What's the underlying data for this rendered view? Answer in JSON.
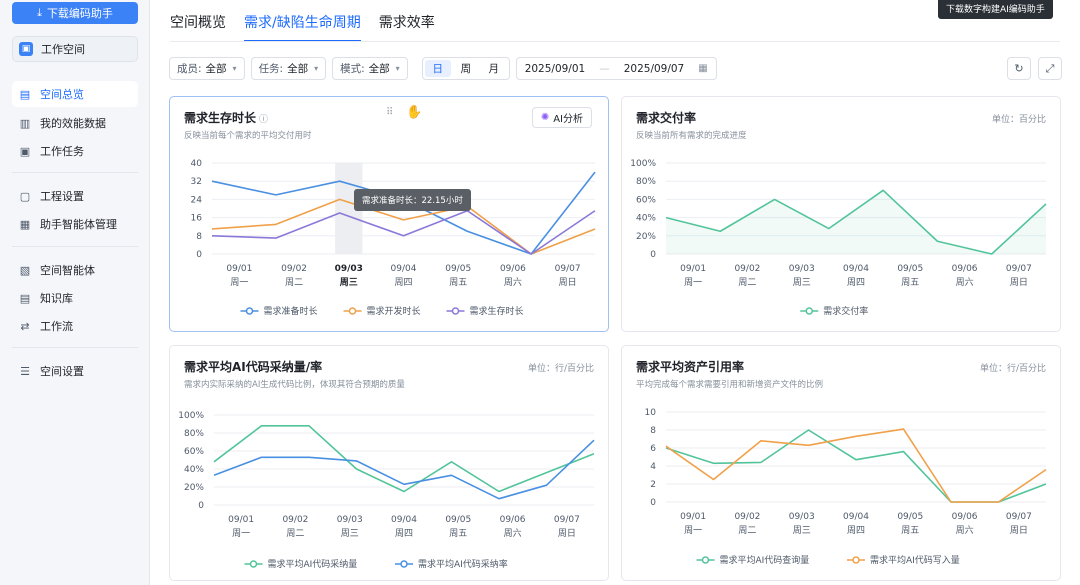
{
  "sidebar": {
    "download_label": "下载编码助手",
    "workspace_label": "工作空间",
    "items": [
      {
        "label": "空间总览",
        "icon": "overview-icon",
        "active": true
      },
      {
        "label": "我的效能数据",
        "icon": "chart-icon"
      },
      {
        "label": "工作任务",
        "icon": "task-icon"
      },
      {
        "label": "工程设置",
        "icon": "project-icon"
      },
      {
        "label": "助手智能体管理",
        "icon": "agent-icon"
      },
      {
        "label": "空间智能体",
        "icon": "space-agent-icon"
      },
      {
        "label": "知识库",
        "icon": "knowledge-icon"
      },
      {
        "label": "工作流",
        "icon": "workflow-icon"
      },
      {
        "label": "空间设置",
        "icon": "settings-icon"
      }
    ]
  },
  "header": {
    "tabs": [
      "空间概览",
      "需求/缺陷生命周期",
      "需求效率"
    ],
    "active_tab": 1,
    "top_tooltip": "下载数字构建AI编码助手"
  },
  "filters": {
    "member": {
      "label": "成员:",
      "value": "全部"
    },
    "task": {
      "label": "任务:",
      "value": "全部"
    },
    "mode": {
      "label": "模式:",
      "value": "全部"
    },
    "granularity": [
      "日",
      "周",
      "月"
    ],
    "granularity_active": 0,
    "date_start": "2025/09/01",
    "date_end": "2025/09/07"
  },
  "x_labels": {
    "dates": [
      "09/01",
      "09/02",
      "09/03",
      "09/04",
      "09/05",
      "09/06",
      "09/07"
    ],
    "weekdays": [
      "周一",
      "周二",
      "周三",
      "周四",
      "周五",
      "周六",
      "周日"
    ]
  },
  "cards": {
    "lifecycle": {
      "title": "需求生存时长",
      "subtitle": "反映当前每个需求的平均交付用时",
      "ai_label": "AI分析",
      "tooltip": "需求准备时长：22.15小时"
    },
    "delivery": {
      "title": "需求交付率",
      "subtitle": "反映当前所有需求的完成进度",
      "unit": "单位：百分比"
    },
    "ai_code": {
      "title": "需求平均AI代码采纳量/率",
      "subtitle": "需求内实际采纳的AI生成代码比例，体现其符合预期的质量",
      "unit": "单位：行/百分比"
    },
    "asset": {
      "title": "需求平均资产引用率",
      "subtitle": "平均完成每个需求需要引用和新增资产文件的比例",
      "unit": "单位：行/百分比"
    }
  },
  "chart_data": [
    {
      "type": "line",
      "title": "需求生存时长",
      "categories": [
        "09/01 周一",
        "09/02 周二",
        "09/03 周三",
        "09/04 周四",
        "09/05 周五",
        "09/06 周六",
        "09/07 周日"
      ],
      "ylim": [
        0,
        40
      ],
      "yticks": [
        0,
        8,
        16,
        24,
        32,
        40
      ],
      "legend": "bottom",
      "series": [
        {
          "name": "需求准备时长",
          "color": "#4a90e2",
          "values": [
            32,
            26,
            32,
            24,
            10,
            0,
            36
          ]
        },
        {
          "name": "需求开发时长",
          "color": "#f0a048",
          "values": [
            11,
            13,
            24,
            15,
            21,
            0,
            11
          ]
        },
        {
          "name": "需求生存时长",
          "color": "#8c78d8",
          "values": [
            8,
            7,
            18,
            8,
            19,
            0,
            19
          ]
        }
      ]
    },
    {
      "type": "area",
      "title": "需求交付率",
      "categories": [
        "09/01 周一",
        "09/02 周二",
        "09/03 周三",
        "09/04 周四",
        "09/05 周五",
        "09/06 周六",
        "09/07 周日"
      ],
      "ylim": [
        0,
        100
      ],
      "yticks": [
        "0",
        "20%",
        "40%",
        "60%",
        "80%",
        "100%"
      ],
      "legend": "bottom",
      "series": [
        {
          "name": "需求交付率",
          "color": "#52c49a",
          "values": [
            40,
            25,
            60,
            28,
            70,
            14,
            0,
            55
          ]
        }
      ]
    },
    {
      "type": "line",
      "title": "需求平均AI代码采纳量/率",
      "categories": [
        "09/01 周一",
        "09/02 周二",
        "09/03 周三",
        "09/04 周四",
        "09/05 周五",
        "09/06 周六",
        "09/07 周日"
      ],
      "ylim": [
        0,
        100
      ],
      "yticks": [
        "0",
        "20%",
        "40%",
        "60%",
        "80%",
        "100%"
      ],
      "legend": "bottom",
      "series": [
        {
          "name": "需求平均AI代码采纳量",
          "color": "#52c49a",
          "values": [
            48,
            88,
            88,
            40,
            15,
            48,
            15,
            36,
            57
          ]
        },
        {
          "name": "需求平均AI代码采纳率",
          "color": "#4a90e2",
          "values": [
            33,
            53,
            53,
            49,
            23,
            33,
            7,
            22,
            72
          ]
        }
      ]
    },
    {
      "type": "line",
      "title": "需求平均资产引用率",
      "categories": [
        "09/01 周一",
        "09/02 周二",
        "09/03 周三",
        "09/04 周四",
        "09/05 周五",
        "09/06 周六",
        "09/07 周日"
      ],
      "ylim": [
        0,
        10
      ],
      "yticks": [
        0,
        2,
        4,
        6,
        8,
        10
      ],
      "legend": "bottom",
      "series": [
        {
          "name": "需求平均AI代码查询量",
          "color": "#52c49a",
          "values": [
            6,
            4.3,
            4.4,
            8,
            4.7,
            5.6,
            0,
            0,
            2
          ]
        },
        {
          "name": "需求平均AI代码写入量",
          "color": "#f0a048",
          "values": [
            6.2,
            2.5,
            6.8,
            6.3,
            7.3,
            8.1,
            0,
            0,
            3.6
          ]
        }
      ]
    }
  ]
}
